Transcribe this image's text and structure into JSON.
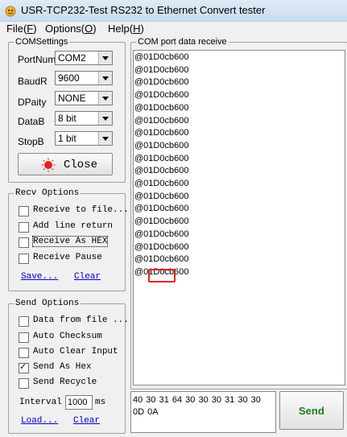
{
  "window": {
    "title": "USR-TCP232-Test  RS232 to Ethernet Convert tester"
  },
  "menu": {
    "file": {
      "label": "File(",
      "key": "F",
      "end": ")"
    },
    "options": {
      "label": "Options(",
      "key": "O",
      "end": ")"
    },
    "help": {
      "label": "Help(",
      "key": "H",
      "end": ")"
    }
  },
  "com_settings": {
    "title": "COMSettings",
    "port_label": "PortNum",
    "port_value": "COM2",
    "baud_label": "BaudR",
    "baud_value": "9600",
    "parity_label": "DPaity",
    "parity_value": "NONE",
    "databits_label": "DataB",
    "databits_value": "8 bit",
    "stopbits_label": "StopB",
    "stopbits_value": "1 bit",
    "close_label": "Close",
    "status_color": "#e2231a"
  },
  "recv_options": {
    "title": "Recv Options",
    "items": [
      {
        "label": "Receive to file...",
        "checked": false
      },
      {
        "label": "Add line return",
        "checked": false
      },
      {
        "label": "Receive As HEX",
        "checked": false
      },
      {
        "label": "Receive Pause",
        "checked": false
      }
    ],
    "save_link": "Save...",
    "clear_link": "Clear"
  },
  "send_options": {
    "title": "Send Options",
    "items": [
      {
        "label": "Data from file ...",
        "checked": false
      },
      {
        "label": "Auto Checksum",
        "checked": false
      },
      {
        "label": "Auto Clear Input",
        "checked": false
      },
      {
        "label": "Send As Hex",
        "checked": true
      },
      {
        "label": "Send Recycle",
        "checked": false
      }
    ],
    "interval_label": "Interval",
    "interval_value": "1000",
    "interval_unit": "ms",
    "load_link": "Load...",
    "clear_link": "Clear"
  },
  "receive_panel": {
    "title": "COM port data receive",
    "lines": [
      "@01D0cb600",
      "@01D0cb600",
      "@01D0cb600",
      "@01D0cb600",
      "@01D0cb600",
      "@01D0cb600",
      "@01D0cb600",
      "@01D0cb600",
      "@01D0cb600",
      "@01D0cb600",
      "@01D0cb600",
      "@01D0cb600",
      "@01D0cb600",
      "@01D0cb600",
      "@01D0cb600",
      "@01D0cb600",
      "@01D0cb600",
      "@01D0cb600"
    ],
    "highlight_color": "#e2231a"
  },
  "send_panel": {
    "text": "40 30 31 64 30 30 30 31 30 30 0D 0A",
    "send_label": "Send",
    "send_color": "#1f7a1f"
  }
}
